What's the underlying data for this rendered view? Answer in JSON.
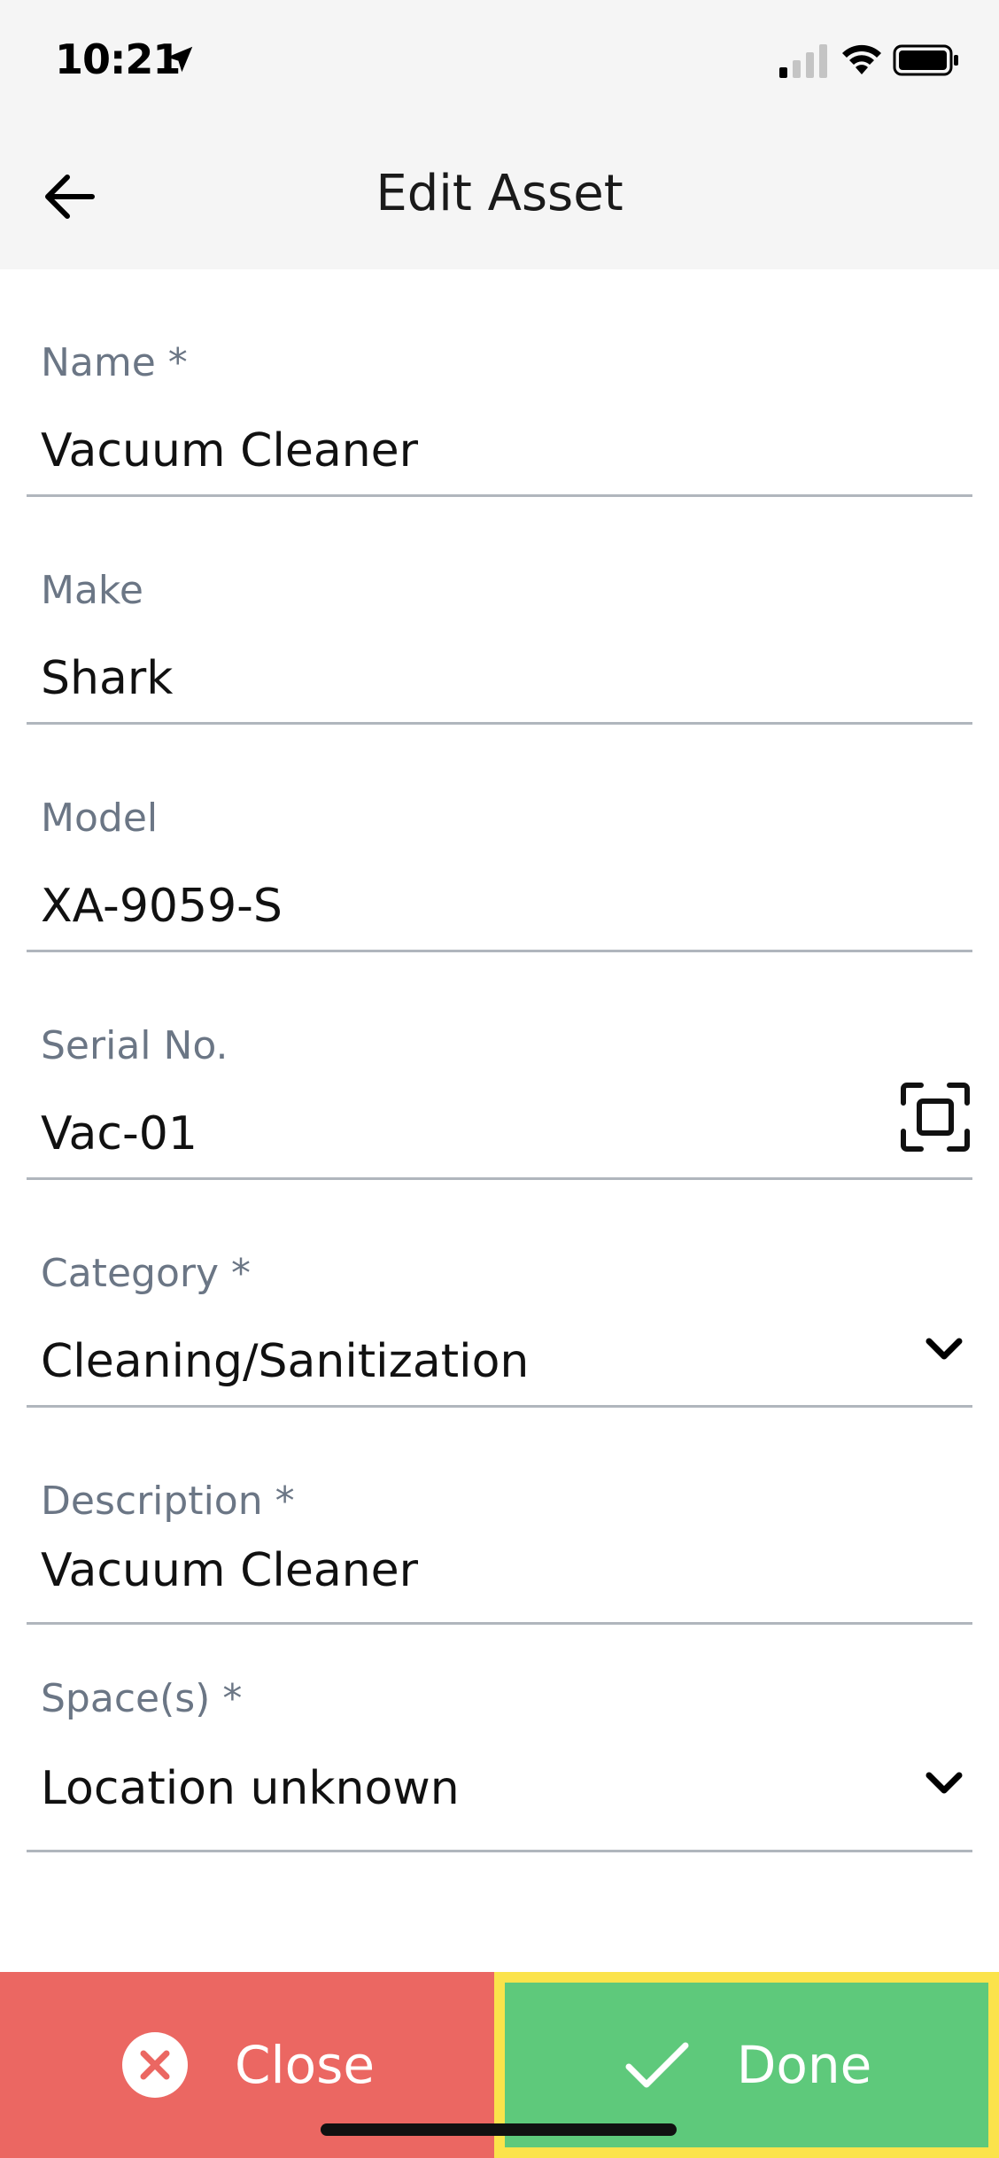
{
  "status_bar": {
    "time": "10:21",
    "icons": [
      "location-arrow-icon",
      "cellular-signal-icon",
      "wifi-icon",
      "battery-icon"
    ]
  },
  "header": {
    "title": "Edit Asset",
    "back_icon": "arrow-left-icon"
  },
  "form": {
    "name": {
      "label": "Name *",
      "value": "Vacuum Cleaner"
    },
    "make": {
      "label": "Make",
      "value": "Shark"
    },
    "model": {
      "label": "Model",
      "value": "XA-9059-S"
    },
    "serial": {
      "label": "Serial No.",
      "value": "Vac-01",
      "action_icon": "scan-icon"
    },
    "category": {
      "label": "Category *",
      "value": "Cleaning/Sanitization",
      "action_icon": "chevron-down-icon"
    },
    "description": {
      "label": "Description *",
      "value": "Vacuum Cleaner"
    },
    "spaces": {
      "label": "Space(s) *",
      "value": "Location unknown",
      "action_icon": "chevron-down-icon"
    }
  },
  "actions": {
    "close": {
      "label": "Close",
      "icon": "close-circle-icon",
      "color": "#eb6762"
    },
    "done": {
      "label": "Done",
      "icon": "checkmark-icon",
      "color": "#5ec97b",
      "highlight": "#fbe34b"
    }
  }
}
